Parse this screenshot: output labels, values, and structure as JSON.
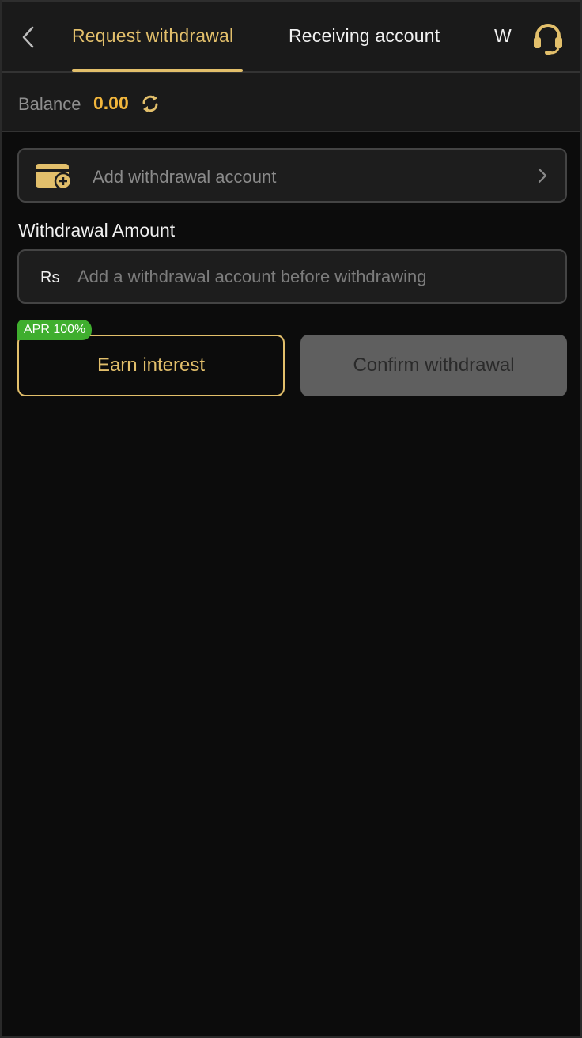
{
  "header": {
    "tabs": [
      {
        "label": "Request withdrawal",
        "active": true
      },
      {
        "label": "Receiving account",
        "active": false
      },
      {
        "label": "W",
        "active": false
      }
    ],
    "icons": {
      "back": "back-arrow-icon",
      "support": "headset-icon"
    }
  },
  "balance": {
    "label": "Balance",
    "value": "0.00",
    "refresh_icon": "refresh-icon"
  },
  "add_account": {
    "label": "Add withdrawal account",
    "icon": "wallet-add-icon",
    "chevron": "chevron-right-icon"
  },
  "amount": {
    "label": "Withdrawal Amount",
    "currency": "Rs",
    "value": "",
    "placeholder": "Add a withdrawal account before withdrawing"
  },
  "actions": {
    "earn_label": "Earn interest",
    "apr_badge": "APR 100%",
    "confirm_label": "Confirm withdrawal"
  },
  "colors": {
    "accent": "#e2bf6b",
    "balance": "#f2b63c",
    "badge": "#3fae2e",
    "background": "#0c0c0c",
    "panel": "#1a1a1a",
    "disabled_button": "#5f5f5f"
  }
}
